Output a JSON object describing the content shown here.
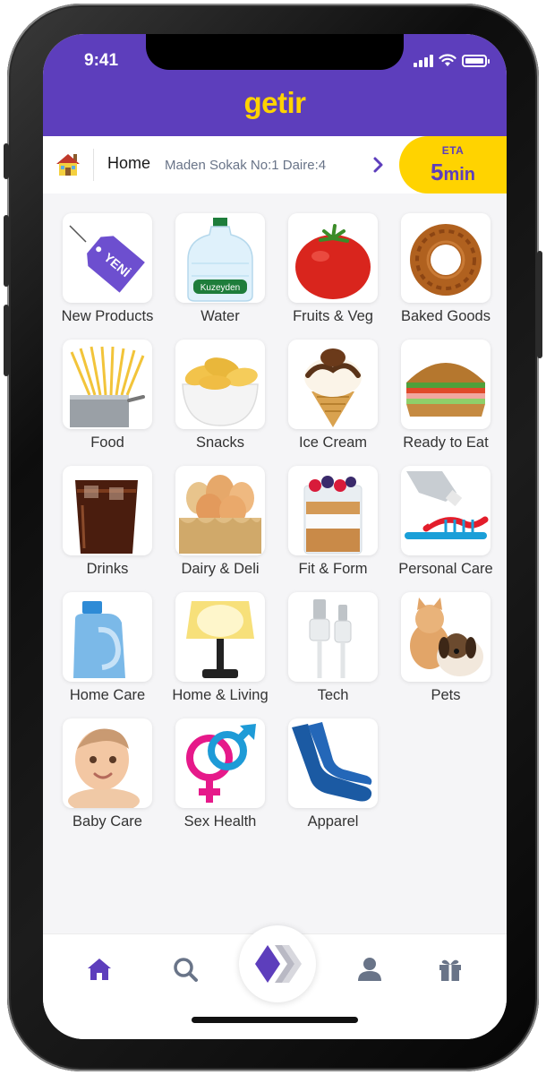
{
  "status_bar": {
    "time": "9:41"
  },
  "header": {
    "logo": "getir"
  },
  "address_bar": {
    "label": "Home",
    "address": "Maden Sokak No:1 Daire:4",
    "eta_label": "ETA",
    "eta_value": "5",
    "eta_unit": "min"
  },
  "categories": [
    {
      "label": "New Products",
      "icon": "new-tag"
    },
    {
      "label": "Water",
      "icon": "water-bottle"
    },
    {
      "label": "Fruits & Veg",
      "icon": "tomato"
    },
    {
      "label": "Baked Goods",
      "icon": "simit"
    },
    {
      "label": "Food",
      "icon": "pasta-pot"
    },
    {
      "label": "Snacks",
      "icon": "chips-bowl"
    },
    {
      "label": "Ice Cream",
      "icon": "ice-cream-cone"
    },
    {
      "label": "Ready to Eat",
      "icon": "sandwich"
    },
    {
      "label": "Drinks",
      "icon": "cola-glass"
    },
    {
      "label": "Dairy & Deli",
      "icon": "eggs"
    },
    {
      "label": "Fit & Form",
      "icon": "parfait"
    },
    {
      "label": "Personal Care",
      "icon": "toothpaste"
    },
    {
      "label": "Home Care",
      "icon": "detergent"
    },
    {
      "label": "Home & Living",
      "icon": "lamp"
    },
    {
      "label": "Tech",
      "icon": "usb-cable"
    },
    {
      "label": "Pets",
      "icon": "cat-dog"
    },
    {
      "label": "Baby Care",
      "icon": "baby"
    },
    {
      "label": "Sex Health",
      "icon": "gender-symbols"
    },
    {
      "label": "Apparel",
      "icon": "socks"
    }
  ],
  "new_tag_text": "YENİ",
  "water_brand": "Kuzeyden",
  "tab_bar": {
    "items": [
      {
        "name": "home",
        "icon": "home-icon",
        "active": true
      },
      {
        "name": "search",
        "icon": "search-icon",
        "active": false
      },
      {
        "name": "getir",
        "icon": "getir-logo-icon",
        "active": false
      },
      {
        "name": "profile",
        "icon": "profile-icon",
        "active": false
      },
      {
        "name": "gifts",
        "icon": "gift-icon",
        "active": false
      }
    ]
  },
  "colors": {
    "brand_purple": "#5d3ebc",
    "brand_yellow": "#ffd300",
    "background": "#f5f5f7",
    "inactive_icon": "#697488"
  }
}
